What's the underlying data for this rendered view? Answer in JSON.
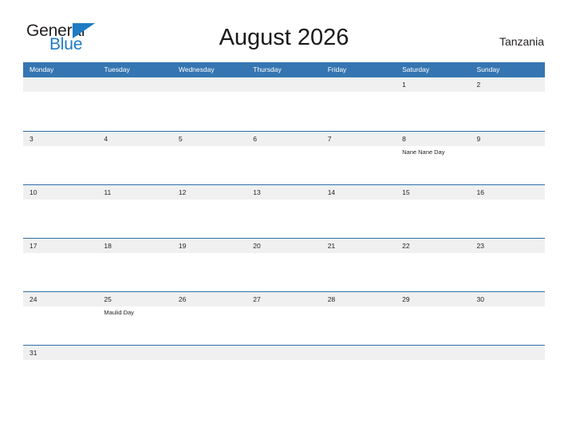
{
  "brand": {
    "name_part1": "General",
    "name_part2": "Blue",
    "flag_icon": "blue-triangle-flag-icon",
    "colors": {
      "dark": "#231f20",
      "blue": "#1e7bc4"
    }
  },
  "header": {
    "title": "August 2026",
    "country": "Tanzania"
  },
  "colors": {
    "header_blue": "#3575b1",
    "row_divider_blue": "#2f6fa8",
    "day_band_gray": "#f0f0f0",
    "text": "#231f20",
    "header_text": "#ffffff"
  },
  "weekdays": [
    {
      "label": "Monday"
    },
    {
      "label": "Tuesday"
    },
    {
      "label": "Wednesday"
    },
    {
      "label": "Thursday"
    },
    {
      "label": "Friday"
    },
    {
      "label": "Saturday"
    },
    {
      "label": "Sunday"
    }
  ],
  "weeks": [
    {
      "days": [
        {
          "number": "",
          "events": []
        },
        {
          "number": "",
          "events": []
        },
        {
          "number": "",
          "events": []
        },
        {
          "number": "",
          "events": []
        },
        {
          "number": "",
          "events": []
        },
        {
          "number": "1",
          "events": []
        },
        {
          "number": "2",
          "events": []
        }
      ]
    },
    {
      "days": [
        {
          "number": "3",
          "events": []
        },
        {
          "number": "4",
          "events": []
        },
        {
          "number": "5",
          "events": []
        },
        {
          "number": "6",
          "events": []
        },
        {
          "number": "7",
          "events": []
        },
        {
          "number": "8",
          "events": [
            {
              "name": "Nane Nane Day"
            }
          ]
        },
        {
          "number": "9",
          "events": []
        }
      ]
    },
    {
      "days": [
        {
          "number": "10",
          "events": []
        },
        {
          "number": "11",
          "events": []
        },
        {
          "number": "12",
          "events": []
        },
        {
          "number": "13",
          "events": []
        },
        {
          "number": "14",
          "events": []
        },
        {
          "number": "15",
          "events": []
        },
        {
          "number": "16",
          "events": []
        }
      ]
    },
    {
      "days": [
        {
          "number": "17",
          "events": []
        },
        {
          "number": "18",
          "events": []
        },
        {
          "number": "19",
          "events": []
        },
        {
          "number": "20",
          "events": []
        },
        {
          "number": "21",
          "events": []
        },
        {
          "number": "22",
          "events": []
        },
        {
          "number": "23",
          "events": []
        }
      ]
    },
    {
      "days": [
        {
          "number": "24",
          "events": []
        },
        {
          "number": "25",
          "events": [
            {
              "name": "Maulid Day"
            }
          ]
        },
        {
          "number": "26",
          "events": []
        },
        {
          "number": "27",
          "events": []
        },
        {
          "number": "28",
          "events": []
        },
        {
          "number": "29",
          "events": []
        },
        {
          "number": "30",
          "events": []
        }
      ]
    },
    {
      "days": [
        {
          "number": "31",
          "events": []
        },
        {
          "number": "",
          "events": []
        },
        {
          "number": "",
          "events": []
        },
        {
          "number": "",
          "events": []
        },
        {
          "number": "",
          "events": []
        },
        {
          "number": "",
          "events": []
        },
        {
          "number": "",
          "events": []
        }
      ]
    }
  ]
}
